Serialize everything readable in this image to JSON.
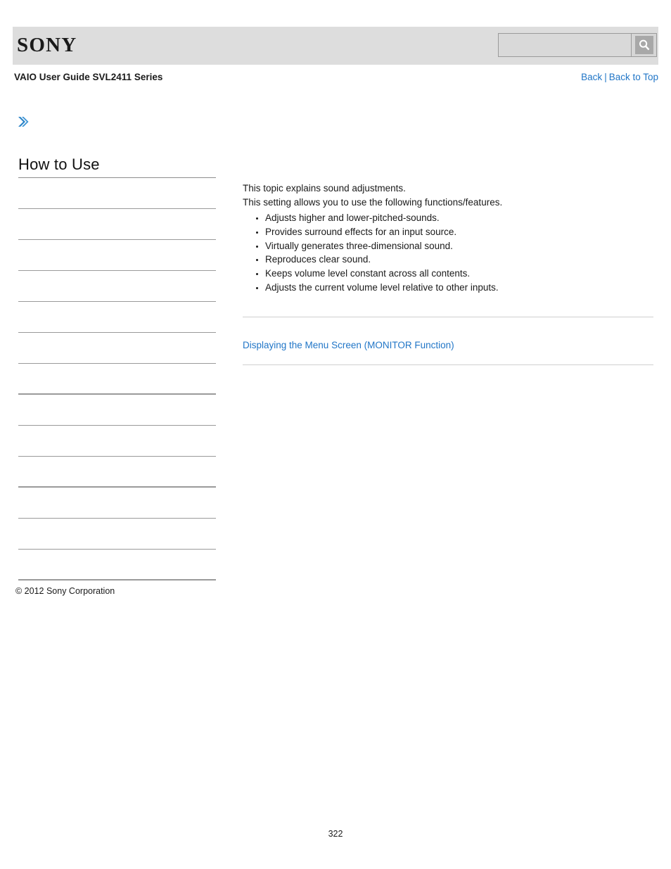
{
  "header": {
    "logo_text": "SONY",
    "search": {
      "value": "",
      "placeholder": "",
      "icon": "search-icon",
      "button_label": ""
    }
  },
  "subheader": {
    "guide_title": "VAIO User Guide SVL2411 Series",
    "nav": {
      "back_label": "Back",
      "separator": "|",
      "back_to_top_label": "Back to Top"
    }
  },
  "sidebar": {
    "arrow_icon": "chevron-double-right-icon",
    "title": "How to Use",
    "items": [
      {
        "label": ""
      },
      {
        "label": ""
      },
      {
        "label": ""
      },
      {
        "label": ""
      },
      {
        "label": ""
      },
      {
        "label": ""
      },
      {
        "label": ""
      },
      {
        "label": ""
      },
      {
        "label": ""
      },
      {
        "label": ""
      },
      {
        "label": ""
      },
      {
        "label": ""
      },
      {
        "label": ""
      }
    ]
  },
  "main": {
    "intro_line_1": "This topic explains sound adjustments.",
    "intro_line_2": "This setting allows you to use the following functions/features.",
    "features": [
      "Adjusts higher and lower-pitched-sounds.",
      "Provides surround effects for an input source.",
      "Virtually generates three-dimensional sound.",
      "Reproduces clear sound.",
      "Keeps volume level constant across all contents.",
      "Adjusts the current volume level relative to other inputs."
    ],
    "related_link": "Displaying the Menu Screen (MONITOR Function)"
  },
  "footer": {
    "copyright": "© 2012 Sony Corporation",
    "page_number": "322"
  },
  "colors": {
    "link_blue": "#2176c7",
    "header_bg": "#dddddd",
    "rule_gray": "#9a9a9a",
    "content_rule": "#cfcfcf"
  }
}
